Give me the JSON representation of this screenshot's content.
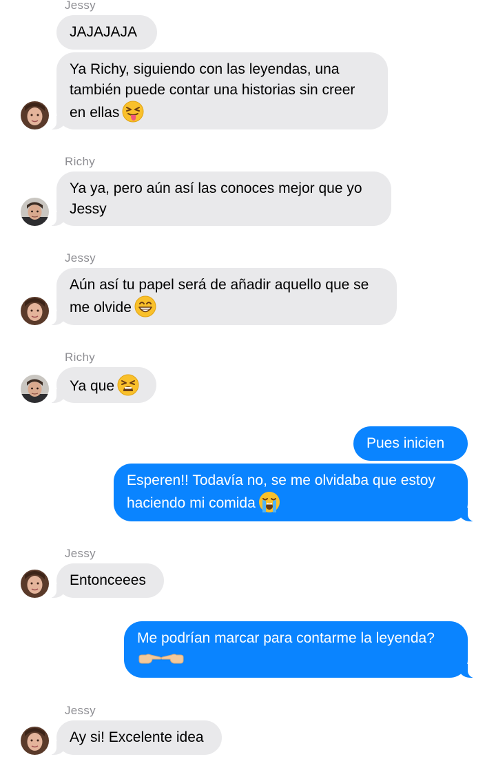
{
  "conversation": [
    {
      "sender": "Jessy",
      "text": "JAJAJAJA"
    },
    {
      "sender": "Jessy",
      "text": "Ya Richy, siguiendo con las leyendas, una también puede contar una historias sin creer en ellas",
      "emoji": "squinting-face-with-tongue-emoji"
    },
    {
      "sender": "Richy",
      "text": "Ya ya, pero aún así las conoces mejor que yo Jessy"
    },
    {
      "sender": "Jessy",
      "text": "Aún así tu papel será de añadir aquello que se me olvide",
      "emoji": "beaming-face-emoji"
    },
    {
      "sender": "Richy",
      "text": "Ya que",
      "emoji": "tired-face-emoji"
    },
    {
      "sender": "me",
      "text": "Pues inicien"
    },
    {
      "sender": "me",
      "text": "Esperen!! Todavía no, se me olvidaba que estoy haciendo mi comida",
      "emoji": "loudly-crying-face-emoji"
    },
    {
      "sender": "Jessy",
      "text": "Entonceees"
    },
    {
      "sender": "me",
      "text": "Me podrían marcar para contarme la leyenda?",
      "emoji": "pointing-fingers-emoji"
    },
    {
      "sender": "Jessy",
      "text": "Ay si! Excelente idea"
    }
  ],
  "colors": {
    "incoming_bubble": "#e9e9eb",
    "outgoing_bubble": "#0a84ff",
    "sender_label": "#8e8e93"
  }
}
